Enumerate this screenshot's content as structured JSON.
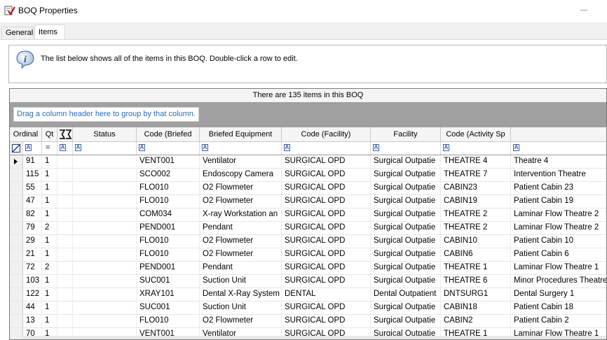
{
  "window": {
    "title": "BOQ Properties"
  },
  "tabs": [
    {
      "label": "General",
      "active": false
    },
    {
      "label": "Items",
      "active": true
    }
  ],
  "info": {
    "text": "The list below shows all of the items in this BOQ. Double-click a row to edit."
  },
  "grid": {
    "caption": "There are 135 items in this BOQ",
    "group_hint": "Drag a column header here to group by that column.",
    "headers": [
      "Ordinal",
      "Qt",
      "",
      "Status",
      "Code (Briefed",
      "Briefed Equipment",
      "Code (Facility)",
      "Facility",
      "Code (Activity Sp",
      "A"
    ],
    "filter_qty_op": "=",
    "rows": [
      [
        "91",
        "1",
        "",
        "",
        "VENT001",
        "Ventilator",
        "SURGICAL OPD",
        "Surgical Outpatie",
        "THEATRE 4",
        "Theatre 4"
      ],
      [
        "115",
        "1",
        "",
        "",
        "SCO002",
        "Endoscopy Camera",
        "SURGICAL OPD",
        "Surgical Outpatie",
        "THEATRE 7",
        "Intervention Theatre"
      ],
      [
        "55",
        "1",
        "",
        "",
        "FLO010",
        "O2 Flowmeter",
        "SURGICAL OPD",
        "Surgical Outpatie",
        "CABIN23",
        "Patient Cabin 23"
      ],
      [
        "47",
        "1",
        "",
        "",
        "FLO010",
        "O2 Flowmeter",
        "SURGICAL OPD",
        "Surgical Outpatie",
        "CABIN19",
        "Patient Cabin 19"
      ],
      [
        "82",
        "1",
        "",
        "",
        "COM034",
        "X-ray Workstation an",
        "SURGICAL OPD",
        "Surgical Outpatie",
        "THEATRE 2",
        "Laminar Flow Theatre 2"
      ],
      [
        "79",
        "2",
        "",
        "",
        "PEND001",
        "Pendant",
        "SURGICAL OPD",
        "Surgical Outpatie",
        "THEATRE 2",
        "Laminar Flow Theatre 2"
      ],
      [
        "29",
        "1",
        "",
        "",
        "FLO010",
        "O2 Flowmeter",
        "SURGICAL OPD",
        "Surgical Outpatie",
        "CABIN10",
        "Patient Cabin 10"
      ],
      [
        "21",
        "1",
        "",
        "",
        "FLO010",
        "O2 Flowmeter",
        "SURGICAL OPD",
        "Surgical Outpatie",
        "CABIN6",
        "Patient Cabin 6"
      ],
      [
        "72",
        "2",
        "",
        "",
        "PEND001",
        "Pendant",
        "SURGICAL OPD",
        "Surgical Outpatie",
        "THEATRE 1",
        "Laminar Flow Theatre 1"
      ],
      [
        "103",
        "1",
        "",
        "",
        "SUC001",
        "Suction Unit",
        "SURGICAL OPD",
        "Surgical Outpatie",
        "THEATRE 6",
        "Minor Procedures Theatre"
      ],
      [
        "122",
        "1",
        "",
        "",
        "XRAY101",
        "Dental X-Ray System",
        "DENTAL",
        "Dental Outpatient",
        "DNTSURG1",
        "Dental Surgery 1"
      ],
      [
        "44",
        "1",
        "",
        "",
        "SUC001",
        "Suction Unit",
        "SURGICAL OPD",
        "Surgical Outpatie",
        "CABIN18",
        "Patient Cabin 18"
      ],
      [
        "13",
        "1",
        "",
        "",
        "FLO010",
        "O2 Flowmeter",
        "SURGICAL OPD",
        "Surgical Outpatie",
        "CABIN2",
        "Patient Cabin 2"
      ],
      [
        "70",
        "1",
        "",
        "",
        "VENT001",
        "Ventilator",
        "SURGICAL OPD",
        "Surgical Outpatie",
        "THEATRE 1",
        "Laminar Flow Theatre 1"
      ]
    ]
  }
}
